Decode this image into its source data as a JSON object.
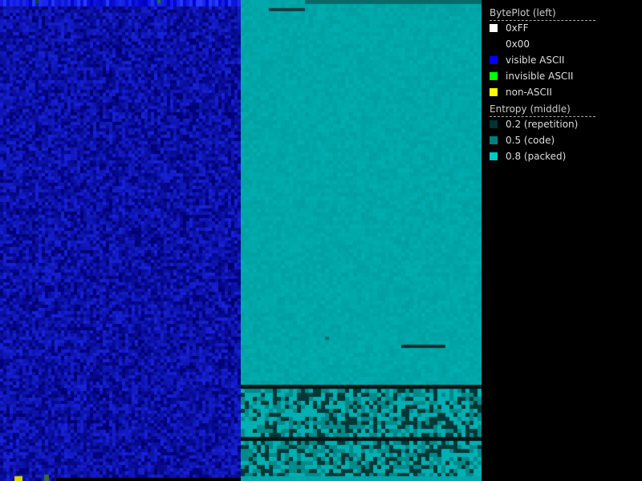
{
  "legend": {
    "byteplot_heading": "BytePlot (left)",
    "byteplot_items": [
      {
        "label": "0xFF",
        "color": "#ffffff"
      },
      {
        "label": "0x00",
        "color": "#000000"
      },
      {
        "label": "visible ASCII",
        "color": "#0000ff"
      },
      {
        "label": "invisible ASCII",
        "color": "#00ff00"
      },
      {
        "label": "non-ASCII",
        "color": "#ffff00"
      }
    ],
    "entropy_heading": "Entropy (middle)",
    "entropy_items": [
      {
        "label": "0.2 (repetition)",
        "color": "#003333"
      },
      {
        "label": "0.5 (code)",
        "color": "#008080"
      },
      {
        "label": "0.8 (packed)",
        "color": "#00c8c8"
      }
    ]
  },
  "colors": {
    "background": "#000000",
    "byteplot_base": "#1020c0",
    "entropy_base": "#00a6a8"
  }
}
